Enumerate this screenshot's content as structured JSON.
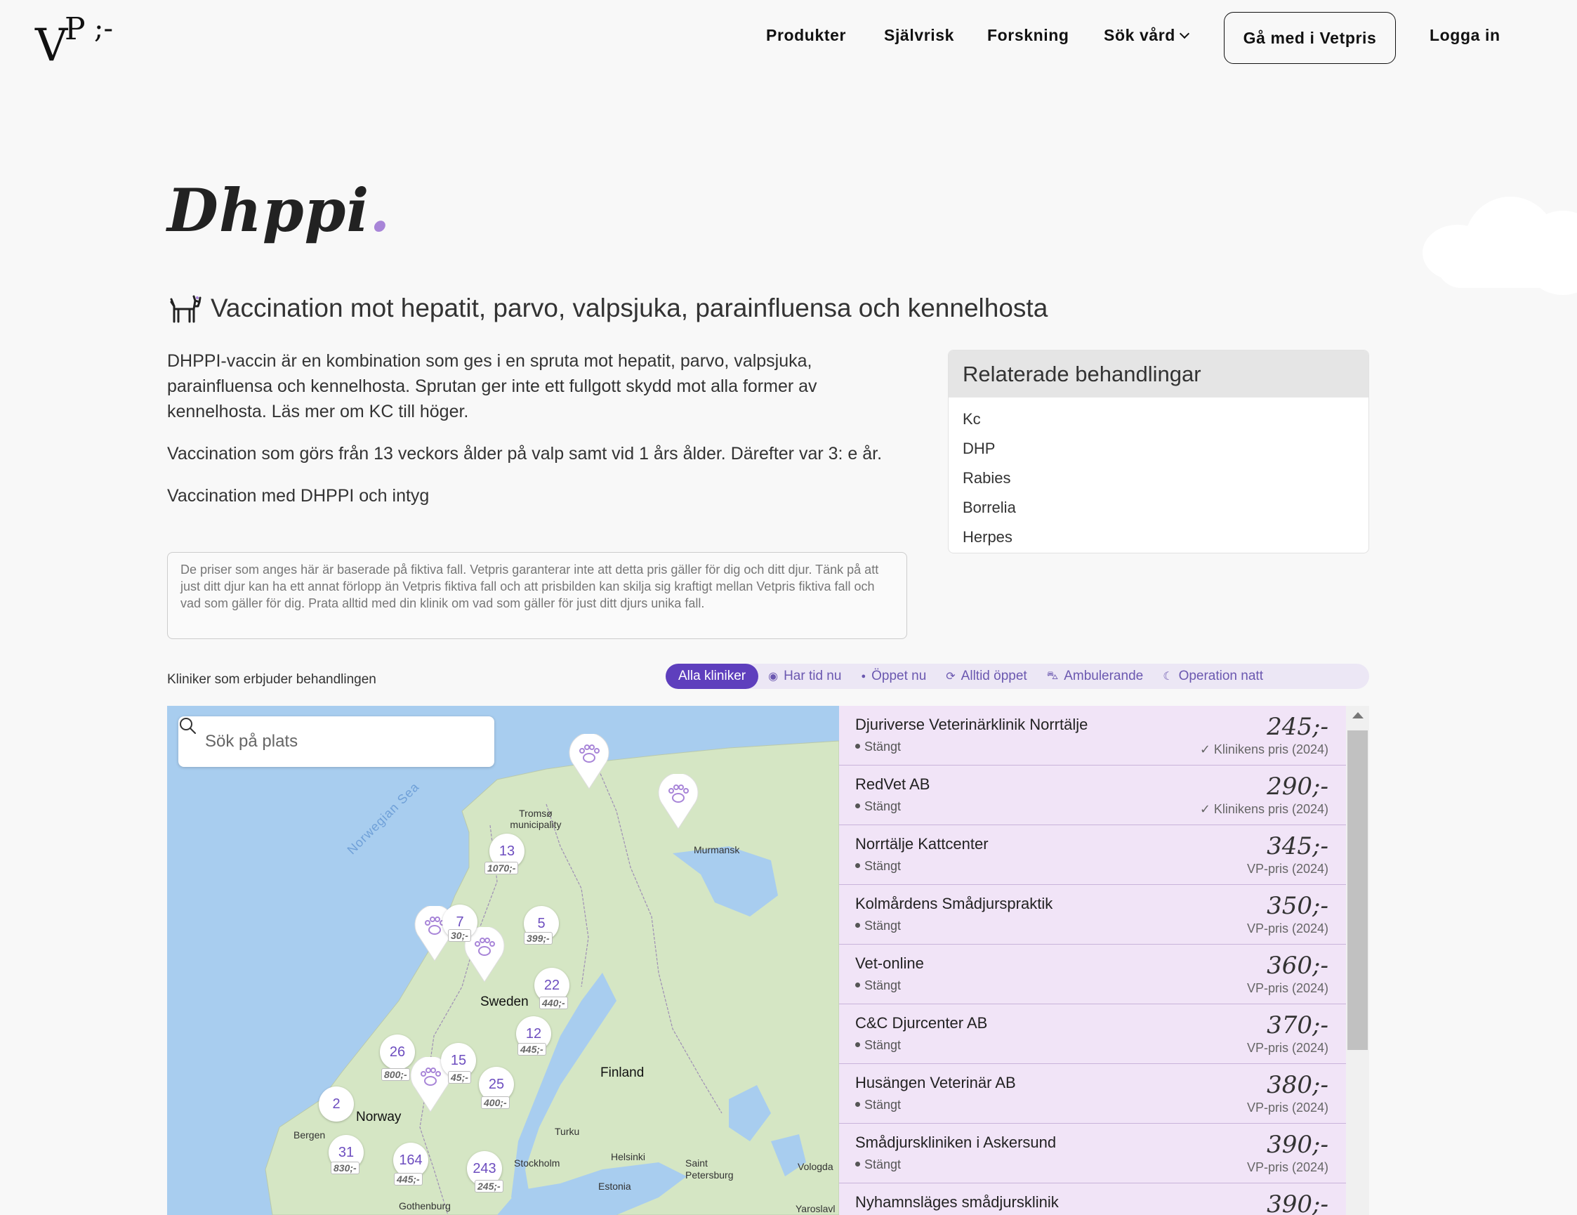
{
  "header": {
    "logo": {
      "v": "V",
      "p": "P",
      "dash": ";-"
    },
    "nav": [
      "Produkter",
      "Självrisk",
      "Forskning",
      "Sök vård"
    ],
    "cta": "Gå med i Vetpris",
    "login": "Logga in"
  },
  "page": {
    "title": "Dhppi",
    "title_dot": ".",
    "subtitle": "Vaccination mot hepatit, parvo, valpsjuka, parainfluensa och kennelhosta",
    "paragraphs": [
      "DHPPI-vaccin är en kombination som ges i en spruta mot hepatit, parvo, valpsjuka, parainfluensa och kennelhosta. Sprutan ger inte ett fullgott skydd mot alla former av kennelhosta. Läs mer om KC till höger.",
      "Vaccination som görs från 13 veckors ålder på valp samt vid 1 års ålder. Därefter var 3: e år.",
      "Vaccination med DHPPI och intyg"
    ],
    "disclaimer": "De priser som anges här är baserade på fiktiva fall. Vetpris garanterar inte att detta pris gäller för dig och ditt djur. Tänk på att just ditt djur kan ha ett annat förlopp än Vetpris fiktiva fall och att prisbilden kan skilja sig kraftigt mellan Vetpris fiktiva fall och vad som gäller för dig. Prata alltid med din klinik om vad som gäller för just ditt djurs unika fall."
  },
  "related": {
    "title": "Relaterade behandlingar",
    "items": [
      "Kc",
      "DHP",
      "Rabies",
      "Borrelia",
      "Herpes"
    ]
  },
  "clinics_section": {
    "label": "Kliniker som erbjuder behandlingen",
    "filters": [
      {
        "label": "Alla kliniker",
        "icon": "",
        "active": true
      },
      {
        "label": "Har tid nu",
        "icon": "◉",
        "active": false
      },
      {
        "label": "Öppet nu",
        "icon": "●",
        "active": false
      },
      {
        "label": "Alltid öppet",
        "icon": "⟳",
        "active": false
      },
      {
        "label": "Ambulerande",
        "icon": "⛍",
        "active": false
      },
      {
        "label": "Operation natt",
        "icon": "☾",
        "active": false
      }
    ]
  },
  "map": {
    "search_placeholder": "Sök på plats",
    "places": [
      "Norwegian Sea",
      "Tromsø municipality",
      "Murmansk",
      "Sweden",
      "Finland",
      "Norway",
      "Bergen",
      "Turku",
      "Helsinki",
      "Stockholm",
      "Saint Petersburg",
      "Vologda",
      "Estonia",
      "Gothenburg",
      "Yaroslavl"
    ],
    "clusters": [
      {
        "count": "13",
        "price": "1070;-"
      },
      {
        "count": "7",
        "price": "30;-"
      },
      {
        "count": "5",
        "price": "399;-"
      },
      {
        "count": "22",
        "price": "440;-"
      },
      {
        "count": "12",
        "price": "445;-"
      },
      {
        "count": "26",
        "price": "800;-"
      },
      {
        "count": "15",
        "price": "45;-"
      },
      {
        "count": "25",
        "price": "400;-"
      },
      {
        "count": "2",
        "price": ""
      },
      {
        "count": "31",
        "price": "830;-"
      },
      {
        "count": "164",
        "price": "445;-"
      },
      {
        "count": "243",
        "price": "245;-"
      }
    ]
  },
  "clinic_list": [
    {
      "name": "Djuriverse Veterinärklinik Norrtälje",
      "status": "Stängt",
      "price": "245;-",
      "source": "✓ Klinikens pris (2024)"
    },
    {
      "name": "RedVet AB",
      "status": "Stängt",
      "price": "290;-",
      "source": "✓ Klinikens pris (2024)"
    },
    {
      "name": "Norrtälje Kattcenter",
      "status": "Stängt",
      "price": "345;-",
      "source": "VP-pris (2024)"
    },
    {
      "name": "Kolmårdens Smådjurspraktik",
      "status": "Stängt",
      "price": "350;-",
      "source": "VP-pris (2024)"
    },
    {
      "name": "Vet-online",
      "status": "Stängt",
      "price": "360;-",
      "source": "VP-pris (2024)"
    },
    {
      "name": "C&C Djurcenter AB",
      "status": "Stängt",
      "price": "370;-",
      "source": "VP-pris (2024)"
    },
    {
      "name": "Husängen Veterinär AB",
      "status": "Stängt",
      "price": "380;-",
      "source": "VP-pris (2024)"
    },
    {
      "name": "Smådjurskliniken i Askersund",
      "status": "Stängt",
      "price": "390;-",
      "source": "VP-pris (2024)"
    },
    {
      "name": "Nyhamnsläges smådjursklinik",
      "status": "",
      "price": "390;-",
      "source": ""
    }
  ],
  "colors": {
    "accent": "#5e3fbd",
    "accent_light": "#ece7f5",
    "list_bg": "#f1e4f7",
    "map_water": "#a8cdef",
    "map_land": "#d5e6c4"
  }
}
